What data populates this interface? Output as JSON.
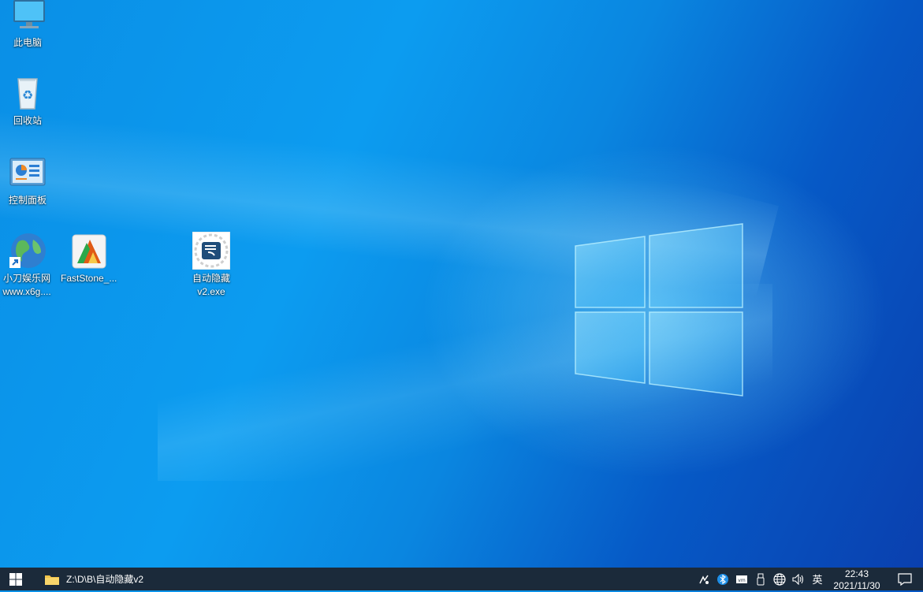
{
  "desktop": {
    "icons": [
      {
        "label": "此电脑",
        "icon": "computer-icon"
      },
      {
        "label": "回收站",
        "icon": "recycle-bin-icon"
      },
      {
        "label": "控制面板",
        "icon": "control-panel-icon"
      },
      {
        "label": "小刀娱乐网\nwww.x6g....",
        "line1": "小刀娱乐网",
        "line2": "www.x6g....",
        "icon": "globe-shortcut-icon"
      },
      {
        "label": "FastStone_...",
        "icon": "faststone-icon"
      },
      {
        "label1": "自动隐藏",
        "label2": "v2.exe",
        "icon": "exe-app-icon"
      }
    ]
  },
  "taskbar": {
    "start_icon": "windows-start-icon",
    "open_window": "Z:\\D\\B\\自动隐藏v2",
    "tray": {
      "ime": "英",
      "time": "22:43",
      "date": "2021/11/30"
    }
  },
  "colors": {
    "taskbar": "#1b2a3a",
    "desktop_accent": "#0a8fe6"
  }
}
